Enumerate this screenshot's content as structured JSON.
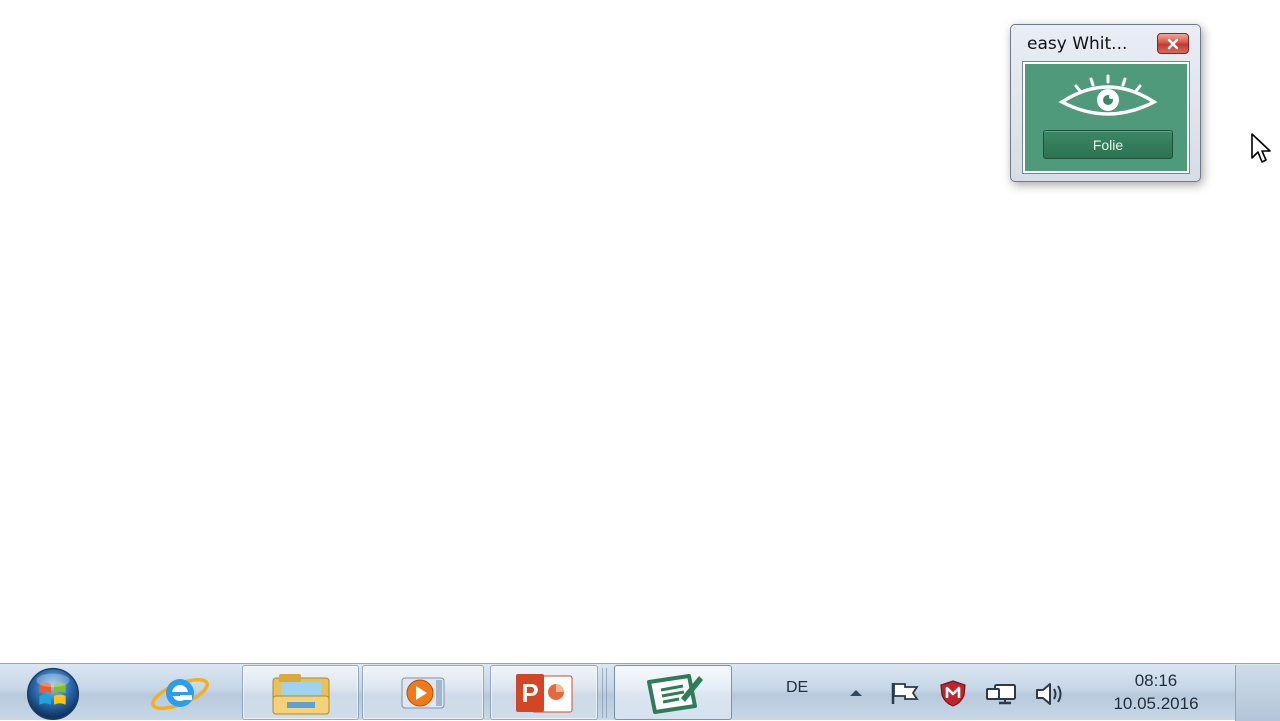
{
  "tool_window": {
    "title": "easy Whit...",
    "close_icon": "close-icon",
    "eye_icon": "eye-icon",
    "folie_button_label": "Folie",
    "panel_color": "#4e9a7a"
  },
  "taskbar": {
    "start_icon": "windows-start-icon",
    "apps": [
      {
        "name": "internet-explorer",
        "icon": "internet-explorer-icon",
        "state": "pinned"
      },
      {
        "name": "windows-explorer",
        "icon": "folder-icon",
        "state": "pinned-active"
      },
      {
        "name": "media-player",
        "icon": "media-player-icon",
        "state": "pinned-active"
      },
      {
        "name": "powerpoint",
        "icon": "powerpoint-icon",
        "state": "pinned-active"
      },
      {
        "name": "easy-whiteboard",
        "icon": "whiteboard-icon",
        "state": "active"
      }
    ],
    "language": "DE",
    "tray_icons": [
      "show-hidden-icons-arrow",
      "action-center-flag-icon",
      "antivirus-shield-icon",
      "network-icon",
      "volume-icon"
    ],
    "clock_time": "08:16",
    "clock_date": "10.05.2016"
  }
}
